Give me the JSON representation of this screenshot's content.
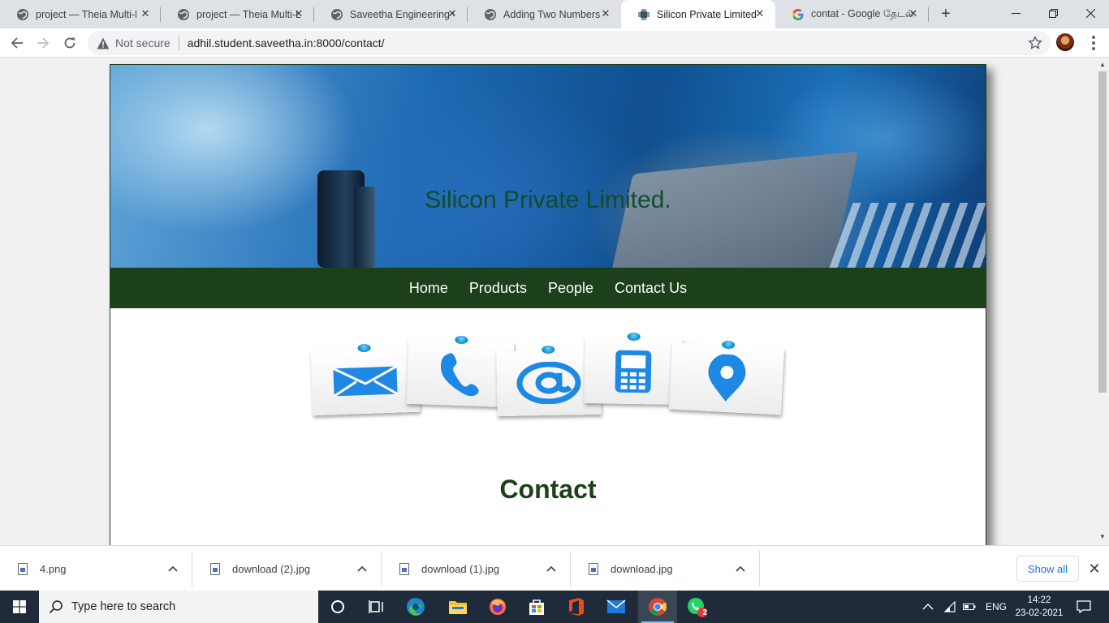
{
  "browser": {
    "tabs": [
      {
        "title": "project — Theia Multi-Language Workspace",
        "active": false,
        "favicon": "globe-icon"
      },
      {
        "title": "project — Theia Multi-Language Workspace",
        "active": false,
        "favicon": "globe-icon"
      },
      {
        "title": "Saveetha Engineering College",
        "active": false,
        "favicon": "globe-icon"
      },
      {
        "title": "Adding Two Numbers",
        "active": false,
        "favicon": "globe-icon"
      },
      {
        "title": "Silicon Private Limited",
        "active": true,
        "favicon": "chip-icon"
      },
      {
        "title": "contat - Google தேடல்",
        "active": false,
        "favicon": "google-icon"
      }
    ],
    "security_label": "Not secure",
    "url": "adhil.student.saveetha.in:8000/contact/"
  },
  "site": {
    "title": "Silicon Private Limited.",
    "nav": [
      "Home",
      "Products",
      "People",
      "Contact Us"
    ],
    "contact_icons": [
      "envelope-icon",
      "phone-icon",
      "at-sign-icon",
      "mobile-phone-icon",
      "location-pin-icon"
    ],
    "heading": "Contact"
  },
  "downloads": {
    "items": [
      "4.png",
      "download (2).jpg",
      "download (1).jpg",
      "download.jpg"
    ],
    "show_all": "Show all"
  },
  "taskbar": {
    "search_placeholder": "Type here to search",
    "language": "ENG",
    "time": "14:22",
    "date": "23-02-2021",
    "whatsapp_badge": "2"
  },
  "colors": {
    "nav_bg": "#1c401a",
    "accent_blue": "#1a73e8",
    "taskbar_bg": "#1f2b3a"
  }
}
